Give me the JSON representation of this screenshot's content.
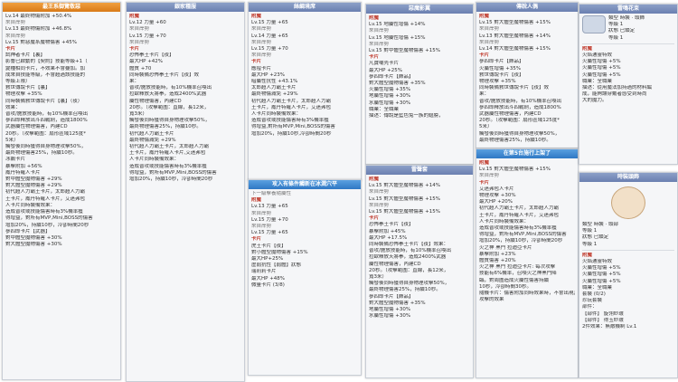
{
  "p1": {
    "title": "最王系御覽敬惡",
    "lines": [
      "Lv.14  最終物傷附加 +50.4%",
      "來自岸勢",
      "Lv.13  最終物傷附加 +46.8%",
      "來自岸勢",
      "Lv.15  對惡魔系魔物傷害 +45%",
      "卡片",
      "試神者卡片【裏】",
      "影響已啟動的【契約】技能等級+1（",
      "變種相同卡片，不效果不會疊加。加",
      "成來自技能等級，不會超過該技能的",
      "等級上限）",
      "救世傳說卡片【裏】",
      "物理攻擊 +35%",
      "同時裝備救世傳說卡片【裏】（夜）",
      "效果：",
      "普攻/施放技能時，有10%機率召喚出",
      "參四郎釋放出斗四戰劍，造成1800%",
      "武器屬性物理傷害，內建CD",
      "20秒。（攻擊範圍：扇形區域125度*",
      "5米）",
      "觸發後同時獲得自身物理攻擊50%，",
      "最終物理傷害25%，持續10秒。",
      "冰鵝卡片",
      "暴擊附加 +56%",
      "鳳丹特羅人卡片",
      "對中體型魔物傷害 +29%",
      "對大體型魔物傷害 +29%",
      "初代超人力霸王卡片，太郎超人力霸",
      "王卡片，鳳丹特羅人卡片，艾迷弗包",
      "人卡片同時裝備效果：",
      "造成普攻或技能傷害時有3%機率獲",
      "得增益，對所有MVP,Mini,BOSS的傷害",
      "增加20%，持續10秒，冷卻時間20秒",
      "參四郎卡片【武器】",
      "對中體型魔物傷害 +30%",
      "對大體型魔物傷害 +30%"
    ]
  },
  "p2": {
    "title": "銀家種服",
    "lines": [
      "附魔",
      "Lv.12  力量 +60",
      "來自岸勢",
      "Lv.15  力量 +70",
      "來自岸勢",
      "卡片",
      "恐怖拳王卡片【夜】",
      "最大HP +42%",
      "體質 +70",
      "同時裝備恐怖拳王卡片【夜】效",
      "果：",
      "普攻/施放技能時，有10%機率召喚出",
      "拉歐釋放天將拳，造成2400%武器",
      "屬性物理傷害，內建CD",
      "20秒。（攻擊範圍：直線，長12米，",
      "寬3米）",
      "觸發後同時獲得自身物理攻擊50%，",
      "最終物理傷害25%，持續10秒。",
      "初代超人力霸王卡片",
      "最終物傷減免 +29%",
      "初代超人力霸王卡片，太郎超人力霸",
      "王卡片，鳳丹特羅人卡片,艾迷弗包",
      "人卡片同時裝備效果：",
      "造成普攻或技能傷害時有3%機率獲",
      "得增益，對所有MVP,Mini,BOSS的傷害",
      "增加20%，持續10秒，冷卻時間20秒"
    ]
  },
  "p3": {
    "title": "絲綢境席",
    "lines": [
      "附魔",
      "Lv.15  力量 +65",
      "來自岸勢",
      "Lv.14  力量 +65",
      "來自岸勢",
      "Lv.15  力量 +70",
      "來自岸勢",
      "卡片",
      "應隍卡片",
      "最大HP +23%",
      "暗屬性抗性 +43.1%",
      "太郎超人力霸王卡片",
      "最終物傷減免 +29%",
      "初代超人力霸王卡片，太郎超人力霸",
      "王卡片，鳳丹特羅人卡片，艾迷弗包",
      "人卡片同時裝備效果：",
      "造成普攻或技能傷害時有3%機率獲",
      "得增益,對所有MVP,Mini,BOSS的傷害",
      "增加20%，持續10秒,冷卻時間20秒"
    ],
    "tip": "攻入有條件觸新在冰潤穴平",
    "lines2": [
      "下一級擊養隨屬性",
      "附魔",
      "Lv.13  力量 +65",
      "來自岸勢",
      "Lv.15  力量 +70",
      "來自岸勢",
      "Lv.15  力量 +65",
      "卡片",
      "虎王卡片【夜】",
      "對小體型魔物傷害 +15%",
      "最大HP+25%",
      "虛弱抗性【弱體】狀態",
      "瑞莉莉卡片",
      "最大HP +48%",
      "微量卡片 (3/8)"
    ]
  },
  "p4": {
    "title": "惡魔影翼",
    "lines": [
      "附魔",
      "Lv.15  地屬性增傷 +14%",
      "來自岸勢",
      "Lv.15  地屬性增傷 +15%",
      "來自岸勢",
      "Lv.15  對中體型魔物傷害 +15%",
      "卡片",
      "凡寶嘲壳卡片",
      "最大HP +25%",
      "參四郎卡片【飾品】",
      "對大體型魔物傷害 +35%",
      "火屬性增傷 +35%",
      "地屬性增傷 +30%",
      "水屬性增傷 +30%",
      "職業：全職業",
      "描述：傳說是藍色兔一族的翅膀，"
    ],
    "tip": "雷聲套",
    "lines2": [
      "附魔",
      "Lv.15  對大體型魔物傷害 +14%",
      "來自岸勢",
      "Lv.15  對大體型魔物傷害 +15%",
      "來自岸勢",
      "Lv.15  對大體型魔物傷害 +15%",
      "卡片",
      "恐怖拳王卡片【夜】",
      "暴擊附加 +45%",
      "最大HP +17.5%",
      "同時裝備恐怖拳王卡片【夜】效果：",
      "普攻/施放技能時，有10%機率召喚出",
      "拉歐釋放天將拳，造成2400%武器",
      "屬性物理傷害，內建CD",
      "20秒。（攻擊範圍：直線，長12米，",
      "寬3米）",
      "觸發後同時獲得自身物理攻擊50%，",
      "最終物理傷害25%，持續10秒。",
      "參四郎卡片【飾品】",
      "對大體型魔物傷害 +35%",
      "地屬性增傷 +30%",
      "水屬性增傷 +30%"
    ]
  },
  "p5": {
    "title": "傳說人偶",
    "lines": [
      "附魔",
      "Lv.15  對大體型魔物傷害 +15%",
      "來自岸勢",
      "Lv.13  對大體型魔物傷害 +14%",
      "來自岸勢",
      "Lv.14  對大體型魔物傷害 +15%",
      "卡片",
      "參四郎卡片【飾品】",
      "火屬性增傷 +35%",
      "救世傳說卡片【夜】",
      "物理攻擊 +35%",
      "同時裝備救世傳說卡片【夜】效",
      "果：",
      "普攻/施放技能時，有10%機率召喚出",
      "參四郎釋放出斗四戰劍，造成1800%",
      "武器屬性物理傷害，內建CD",
      "20秒。（攻擊範圍：扇形區域125度*",
      "5米）",
      "觸發後同時獲得自身物理攻擊50%，",
      "最終物理傷害25%，持續10秒。"
    ],
    "tip": "在第5台施行上架了",
    "lines2": [
      "附魔",
      "Lv.15  對大體型魔物傷害 +15%",
      "來自岸勢",
      "卡片",
      "艾迷弗包人卡片",
      "物理攻擊 +30%",
      "最大HP +20%",
      "初代超人力霸王卡片，太郎超人力霸",
      "王卡片，鳳丹特羅人卡片，艾迷弗包",
      "人卡片同時裝備效果：",
      "造成普攻或技能傷害時有3%機率獲",
      "得增益，對所有MVP,Mini,BOSS的傷害",
      "增加20%，持續10秒，冷卻時間20秒",
      "火之神 黑門 拉迪亞卡片",
      "暴擊附加 +23%",
      "體質傷害 +20%",
      "火之神 黑門 拉迪亞卡片: 每次攻擊",
      "技能有6%機率，召喚火之神黑門降",
      "臨，對周圍造成火屬性傷害持續",
      "10秒，冷卻時間30秒。",
      "隨機卡片：傷害附加同時效果時，不會出現其他",
      "攻擊的效果"
    ]
  },
  "p6": {
    "title": "雷鳴花束",
    "info": [
      "類型  時裝 · 頭飾",
      "等級 1",
      "狀態 已鎖定",
      "等級 1"
    ],
    "lines": [
      "附魔",
      "火焰通靈特效",
      "火屬性增傷 +5%",
      "火屬性增傷 +5%",
      "火屬性增傷 +5%",
      "職業：全職業",
      "描述：從用魔法加持過的材料編",
      "成，能夠讓穿戴者感受到時尚",
      "大的魔力。"
    ]
  },
  "p7": {
    "title": "時裝頭飾",
    "info": [
      "類型  時裝 · 頭部",
      "等級 1",
      "狀態 已鎖定",
      "等級 1"
    ],
    "lines": [
      "附魔",
      "火焰通靈特效",
      "火屬性增傷 +5%",
      "火屬性增傷 +5%",
      "火屬性增傷 +5%",
      "職業：全職業",
      "套裝 (0/2)",
      "珍玩套裝",
      "部件：",
      "【部件】 旋翎紗環",
      "【部件】 得玉紗環",
      "2件效果：無敵機制 Lv.1"
    ]
  }
}
